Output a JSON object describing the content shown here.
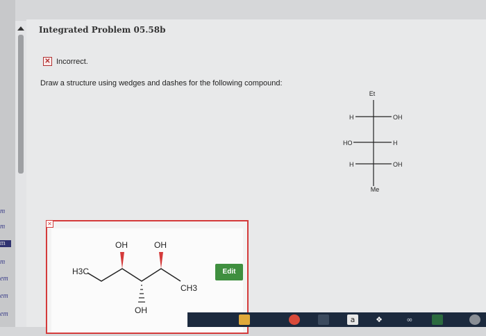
{
  "left_marks": [
    "m",
    "m",
    "m",
    "m",
    "em",
    "em",
    "em"
  ],
  "header": {
    "title": "Integrated Problem 05.58b"
  },
  "feedback": {
    "icon": "x-box-icon",
    "status": "Incorrect."
  },
  "question": {
    "prompt": "Draw a structure using wedges and dashes for the following compound:"
  },
  "fischer": {
    "top": "Et",
    "bottom": "Me",
    "rows": [
      {
        "left": "H",
        "right": "OH"
      },
      {
        "left": "HO",
        "right": "H"
      },
      {
        "left": "H",
        "right": "OH"
      }
    ]
  },
  "answer": {
    "labels": {
      "oh_top_left": "OH",
      "oh_top_right": "OH",
      "h3c": "H3C",
      "ch3": "CH3",
      "oh_bottom": "OH"
    },
    "edit_label": "Edit"
  },
  "taskbar": {
    "icons": [
      "file-explorer-icon",
      "chrome-icon",
      "store-icon",
      "amazon-icon",
      "dropbox-icon",
      "infinity-icon",
      "taskbar-app-icon"
    ],
    "amazon_letter": "a"
  },
  "colors": {
    "error": "#d43a3a",
    "edit": "#3f8f3f",
    "taskbar": "#1c2a3e"
  }
}
